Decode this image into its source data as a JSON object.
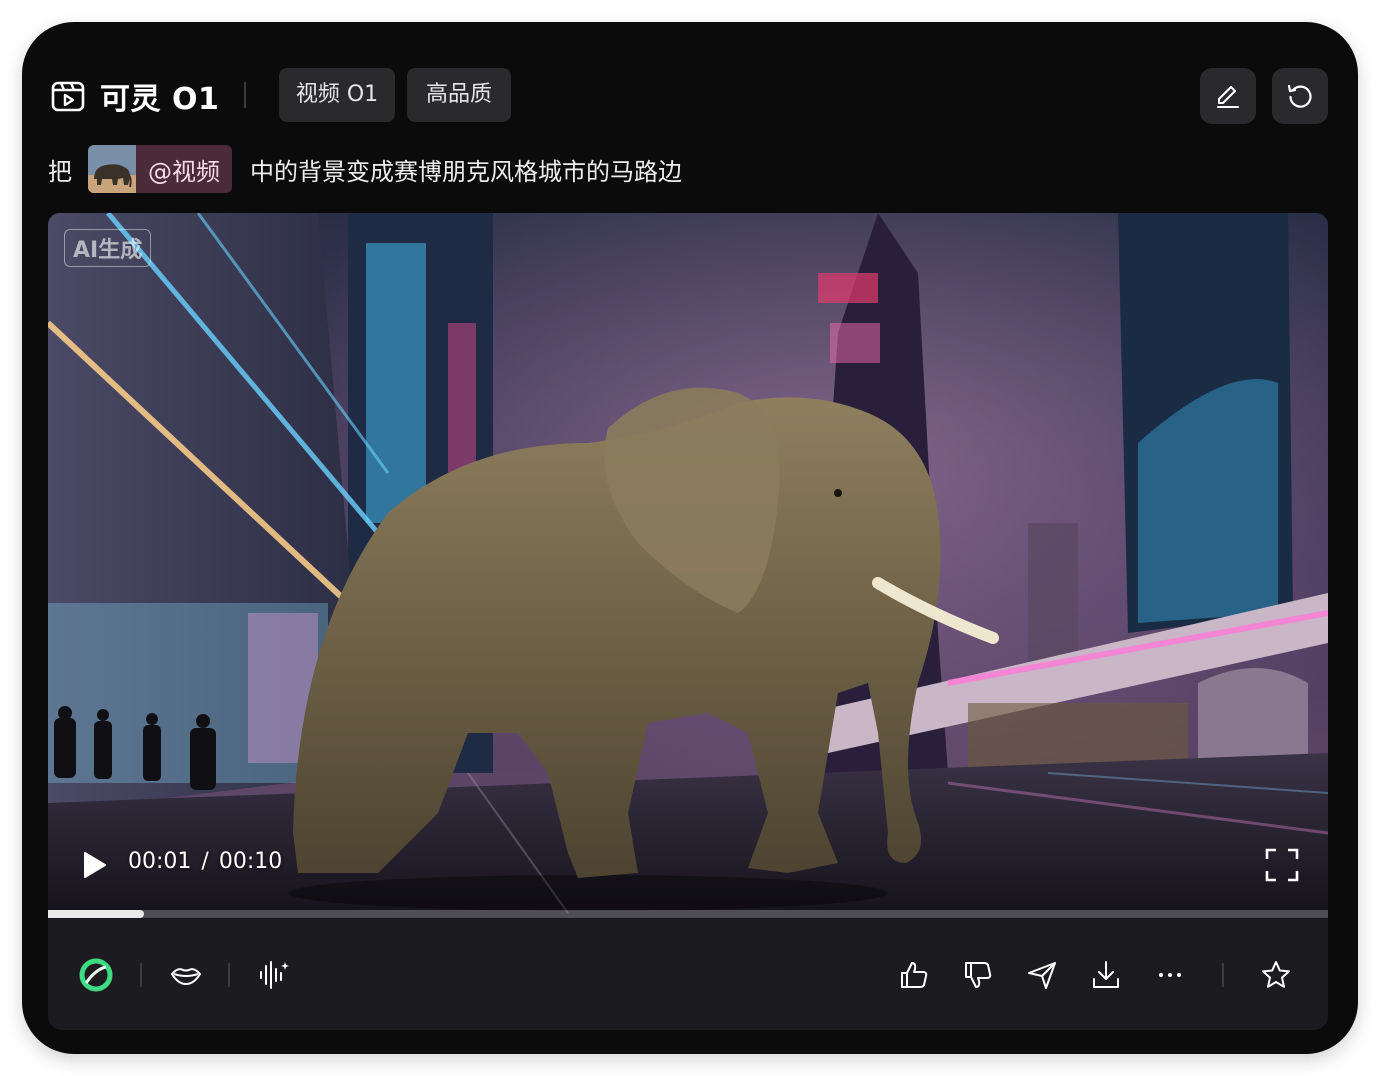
{
  "header": {
    "brand": "可灵 O1",
    "brand_icon": "video-clapper-icon",
    "tags": [
      "视频 O1",
      "高品质"
    ],
    "edit_icon": "pencil-icon",
    "redo_icon": "refresh-icon"
  },
  "prompt": {
    "prefix": "把",
    "chip_label": "@视频",
    "chip_color": "#4b2a3a",
    "suffix": "中的背景变成赛博朋克风格城市的马路边"
  },
  "video": {
    "watermark": "AI生成",
    "current_time": "00:01",
    "separator": "/",
    "duration": "00:10",
    "progress_fraction": 0.075,
    "subject": "elephant-on-cyberpunk-street"
  },
  "toolbar": {
    "left_icons": [
      "kling-logo-icon",
      "lips-icon",
      "audio-waveform-icon"
    ],
    "right_icons": [
      "thumbs-up-icon",
      "thumbs-down-icon",
      "send-icon",
      "download-icon",
      "more-icon",
      "star-icon"
    ],
    "accent": "#3ddc84"
  }
}
